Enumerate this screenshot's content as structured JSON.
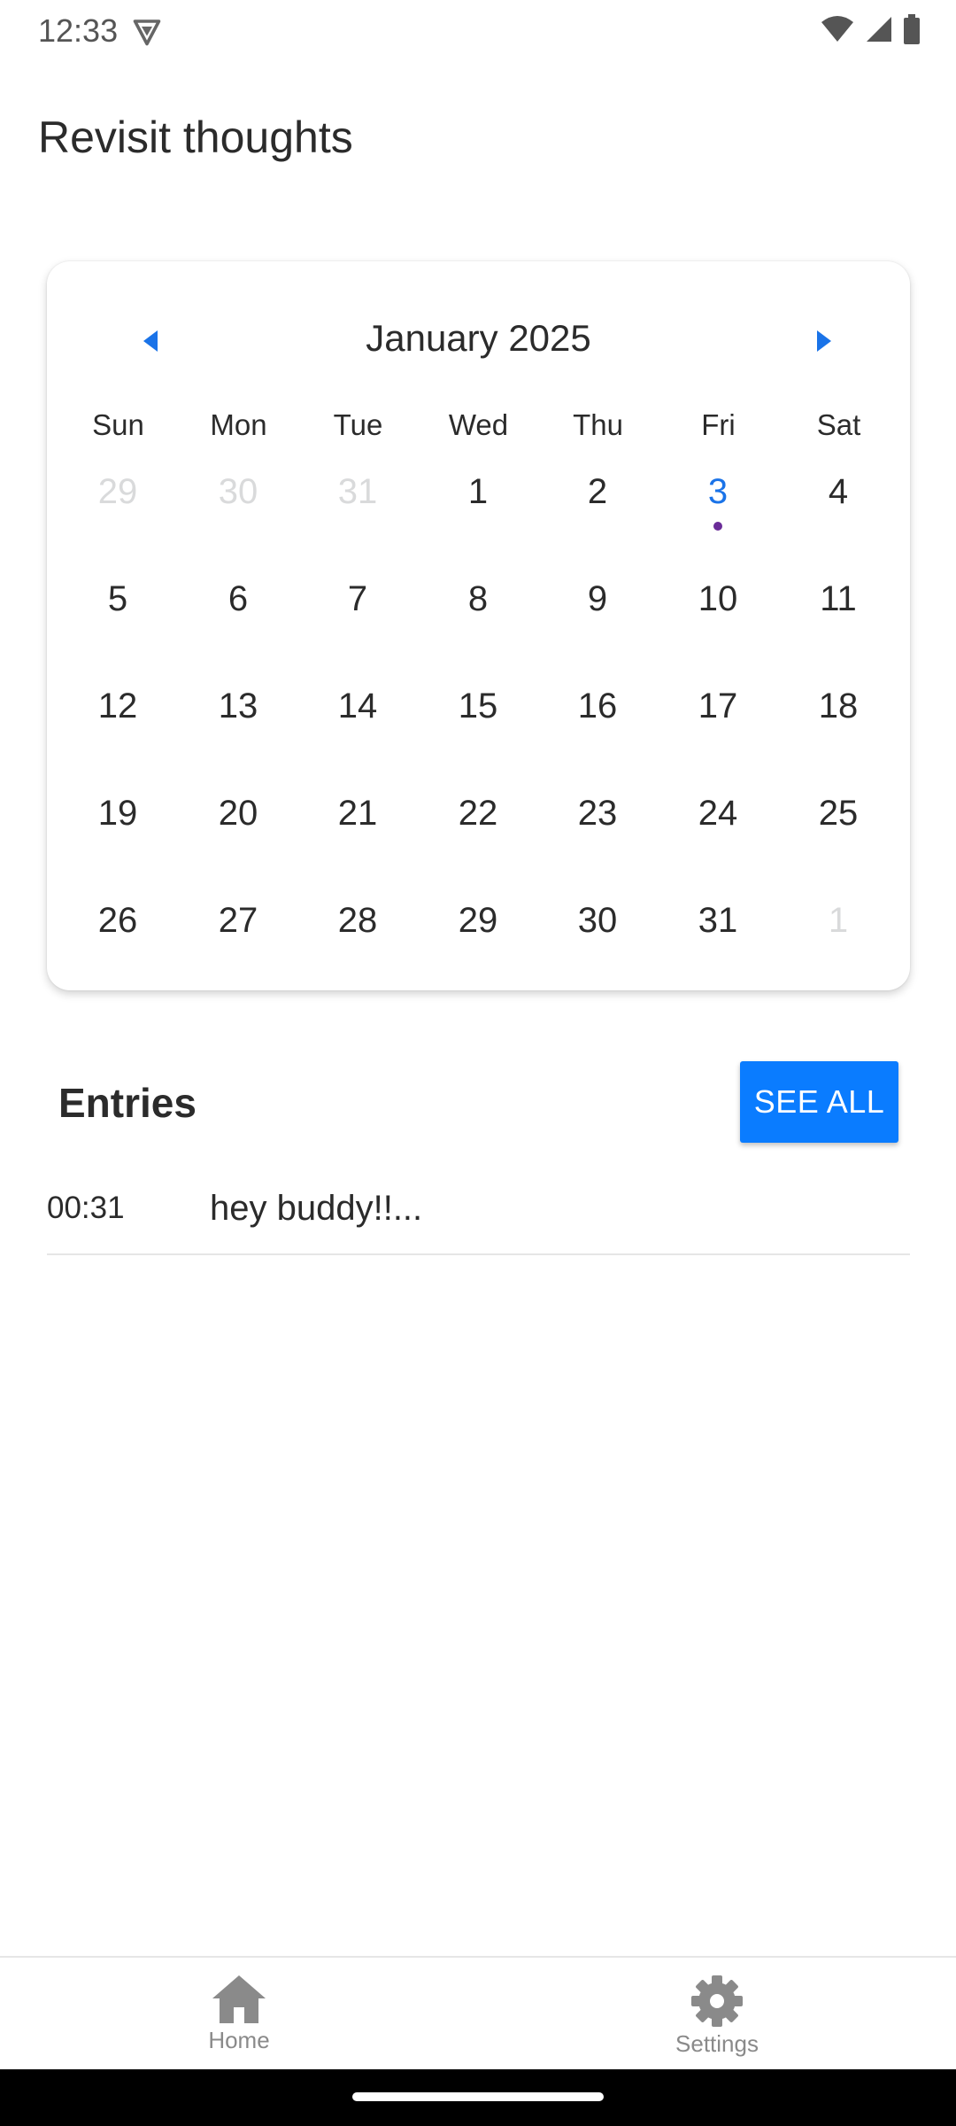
{
  "status_bar": {
    "time": "12:33"
  },
  "header": {
    "title": "Revisit thoughts"
  },
  "calendar": {
    "month_label": "January 2025",
    "accent_color": "#1a73e8",
    "weekdays": [
      "Sun",
      "Mon",
      "Tue",
      "Wed",
      "Thu",
      "Fri",
      "Sat"
    ],
    "weeks": [
      [
        {
          "d": "29",
          "muted": true
        },
        {
          "d": "30",
          "muted": true
        },
        {
          "d": "31",
          "muted": true
        },
        {
          "d": "1"
        },
        {
          "d": "2"
        },
        {
          "d": "3",
          "today": true,
          "dot": true
        },
        {
          "d": "4"
        }
      ],
      [
        {
          "d": "5"
        },
        {
          "d": "6"
        },
        {
          "d": "7"
        },
        {
          "d": "8"
        },
        {
          "d": "9"
        },
        {
          "d": "10"
        },
        {
          "d": "11"
        }
      ],
      [
        {
          "d": "12"
        },
        {
          "d": "13"
        },
        {
          "d": "14"
        },
        {
          "d": "15"
        },
        {
          "d": "16"
        },
        {
          "d": "17"
        },
        {
          "d": "18"
        }
      ],
      [
        {
          "d": "19"
        },
        {
          "d": "20"
        },
        {
          "d": "21"
        },
        {
          "d": "22"
        },
        {
          "d": "23"
        },
        {
          "d": "24"
        },
        {
          "d": "25"
        }
      ],
      [
        {
          "d": "26"
        },
        {
          "d": "27"
        },
        {
          "d": "28"
        },
        {
          "d": "29"
        },
        {
          "d": "30"
        },
        {
          "d": "31"
        },
        {
          "d": "1",
          "muted": true
        }
      ]
    ]
  },
  "entries": {
    "title": "Entries",
    "see_all_label": "SEE ALL",
    "button_color": "#0a7cff",
    "items": [
      {
        "time": "00:31",
        "text": "hey buddy!!..."
      }
    ]
  },
  "bottom_nav": {
    "items": [
      {
        "label": "Home",
        "icon": "home-icon"
      },
      {
        "label": "Settings",
        "icon": "gear-icon"
      }
    ]
  }
}
